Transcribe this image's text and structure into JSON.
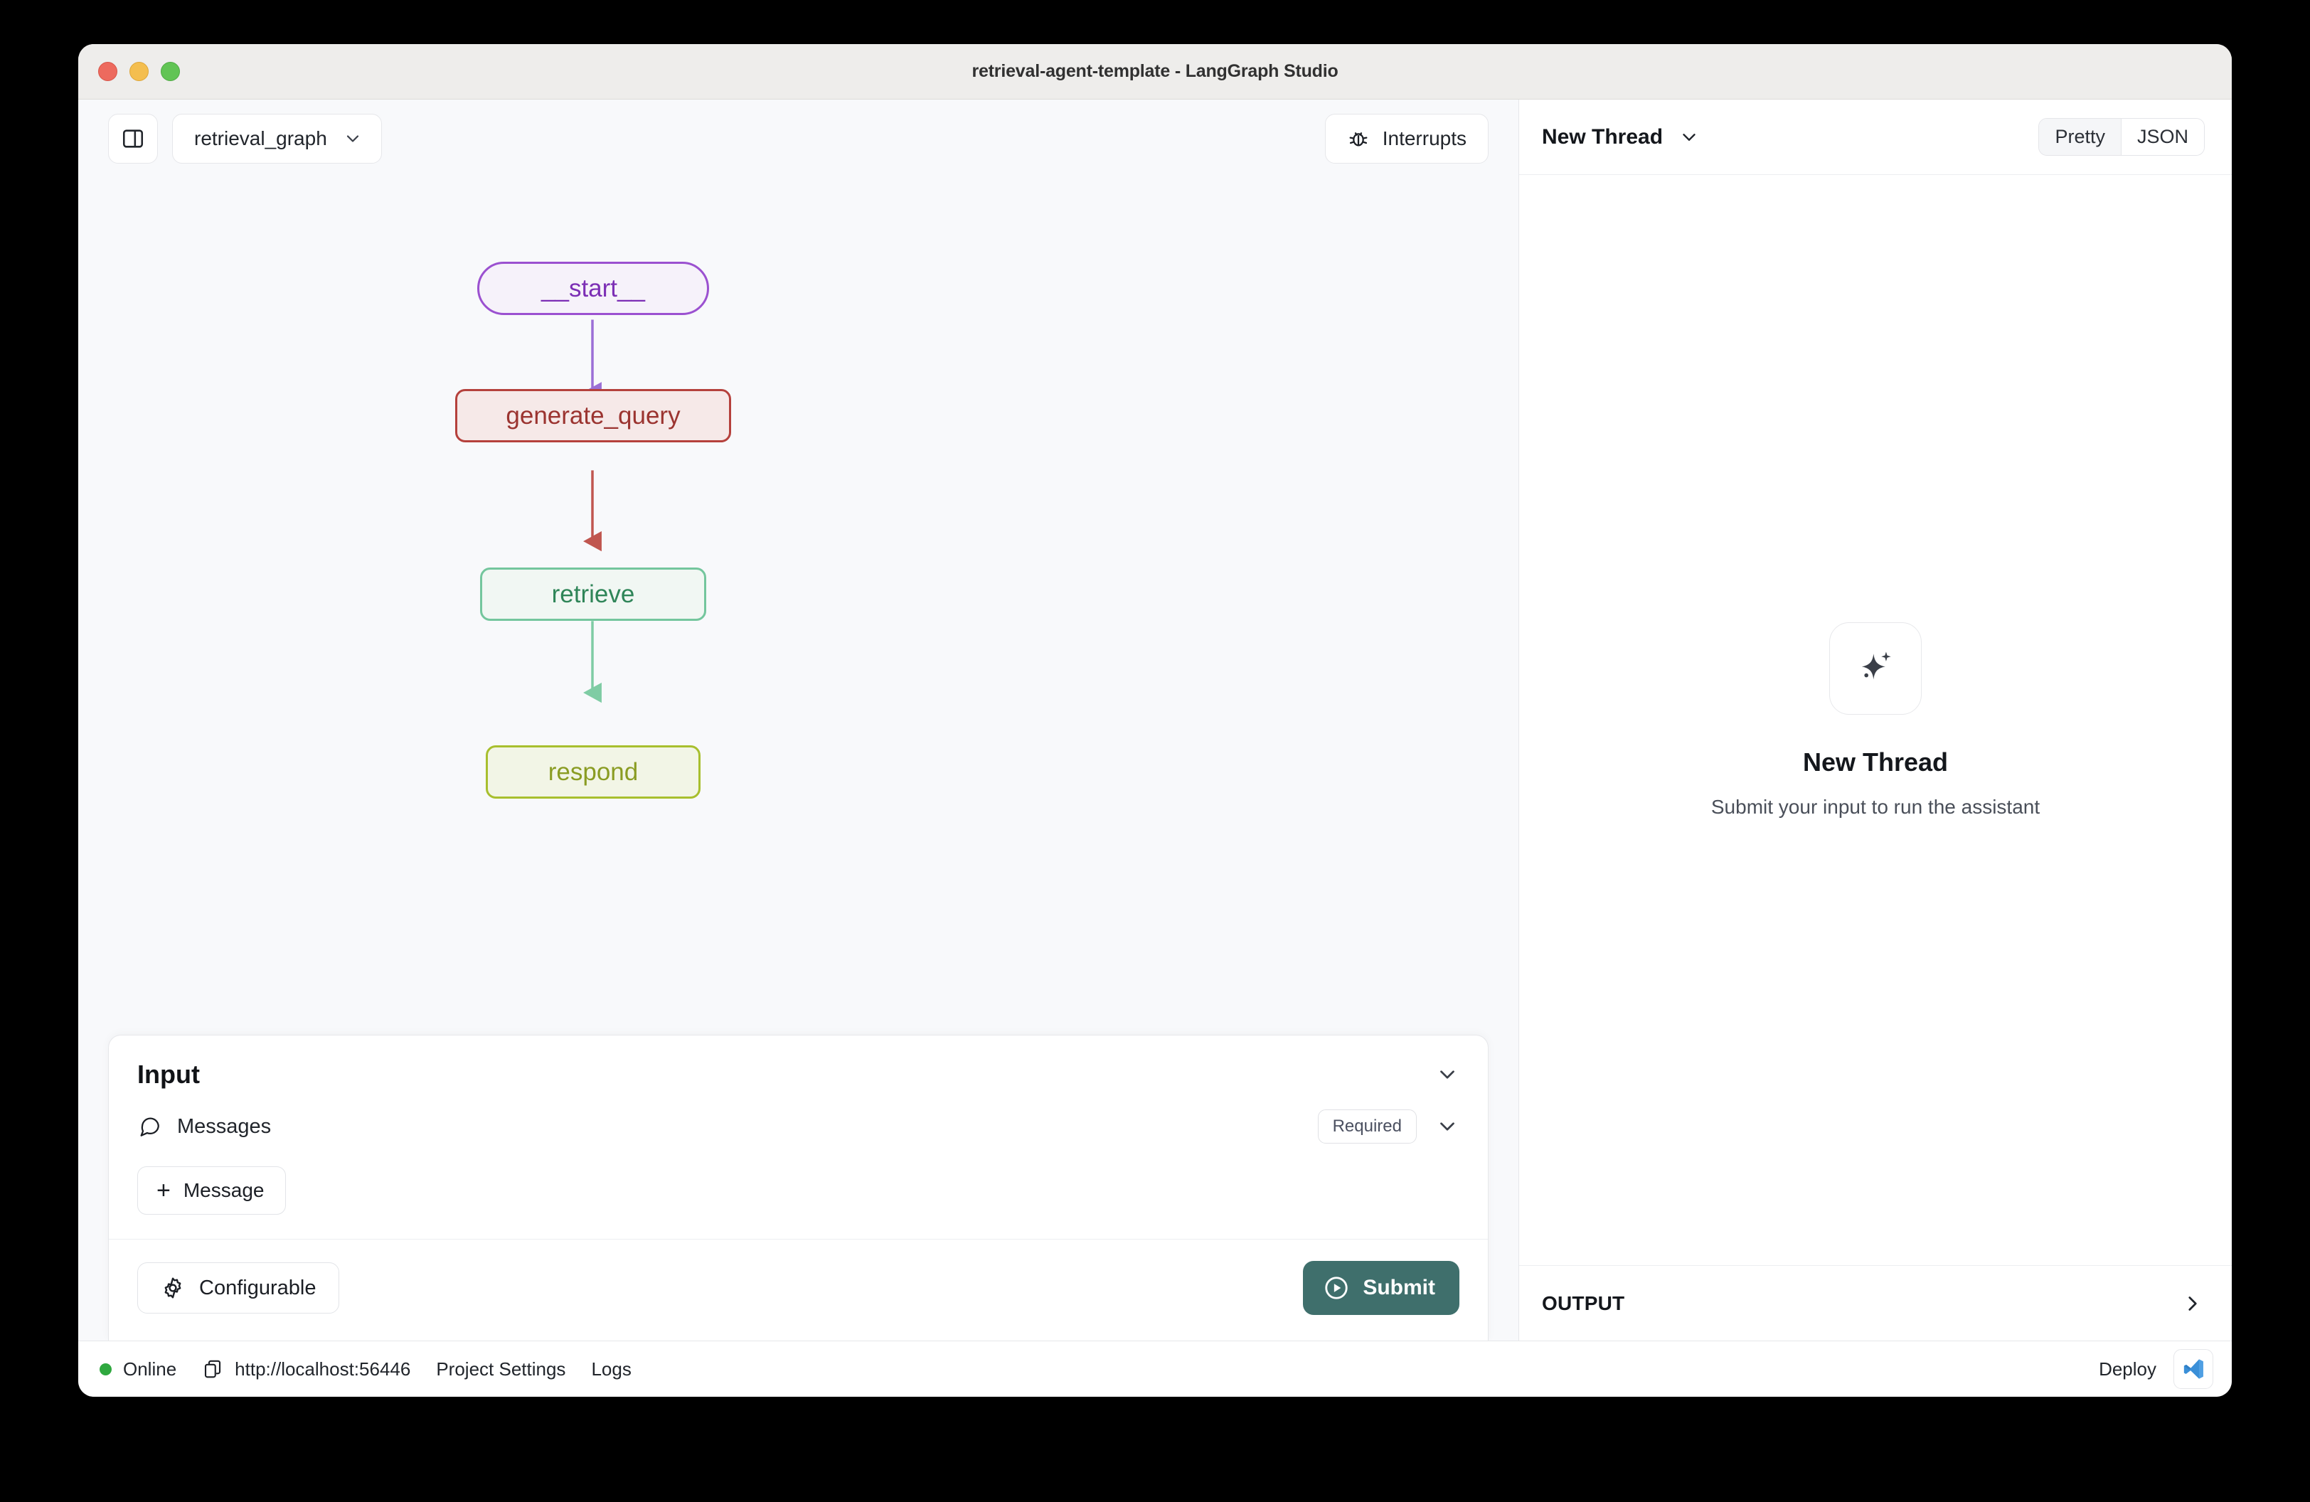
{
  "window": {
    "title": "retrieval-agent-template - LangGraph Studio",
    "traffic_lights": [
      "close",
      "minimize",
      "zoom"
    ]
  },
  "left_toolbar": {
    "sidebar_toggle_icon": "panel-left-icon",
    "graph_select_value": "retrieval_graph",
    "graph_select_caret": "chevron-down-icon",
    "interrupts_label": "Interrupts",
    "interrupts_icon": "bug-icon"
  },
  "graph": {
    "nodes": [
      {
        "id": "start",
        "label": "__start__",
        "shape": "pill",
        "border": "#9b51d0",
        "fill": "#f6f2fa",
        "text": "#7c2fb5"
      },
      {
        "id": "generate_query",
        "label": "generate_query",
        "shape": "rect",
        "border": "#b5413c",
        "fill": "#f6e9e8",
        "text": "#9b3430"
      },
      {
        "id": "retrieve",
        "label": "retrieve",
        "shape": "rect",
        "border": "#74c69d",
        "fill": "#f1f7f3",
        "text": "#2f8558"
      },
      {
        "id": "respond",
        "label": "respond",
        "shape": "rect",
        "border": "#a8bf2e",
        "fill": "#f2f5e6",
        "text": "#8a9c23"
      }
    ],
    "edges": [
      {
        "from": "start",
        "to": "generate_query",
        "color": "#9b6fd6"
      },
      {
        "from": "generate_query",
        "to": "retrieve",
        "color": "#c0564f"
      },
      {
        "from": "retrieve",
        "to": "respond",
        "color": "#7fccA4"
      }
    ]
  },
  "input_card": {
    "title": "Input",
    "collapse_icon": "chevron-down-icon",
    "messages_label": "Messages",
    "messages_icon": "message-bubble-icon",
    "required_badge": "Required",
    "messages_caret": "chevron-down-icon",
    "add_message_label": "Message",
    "add_message_icon": "plus-icon",
    "configurable_label": "Configurable",
    "configurable_icon": "gear-icon",
    "submit_label": "Submit",
    "submit_icon": "play-circle-icon",
    "submit_color": "#3f6f6c"
  },
  "thread_panel": {
    "title": "New Thread",
    "title_caret": "chevron-down-icon",
    "view_modes": [
      {
        "label": "Pretty",
        "active": true
      },
      {
        "label": "JSON",
        "active": false
      }
    ],
    "empty_state": {
      "icon": "sparkles-icon",
      "title": "New Thread",
      "subtitle": "Submit your input to run the assistant"
    },
    "output_label": "OUTPUT",
    "output_caret": "chevron-right-icon"
  },
  "statusbar": {
    "status_text": "Online",
    "status_color": "#2fa83f",
    "copy_icon": "copy-icon",
    "url": "http://localhost:56446",
    "project_settings_label": "Project Settings",
    "logs_label": "Logs",
    "deploy_label": "Deploy",
    "vscode_icon": "vscode-icon"
  }
}
